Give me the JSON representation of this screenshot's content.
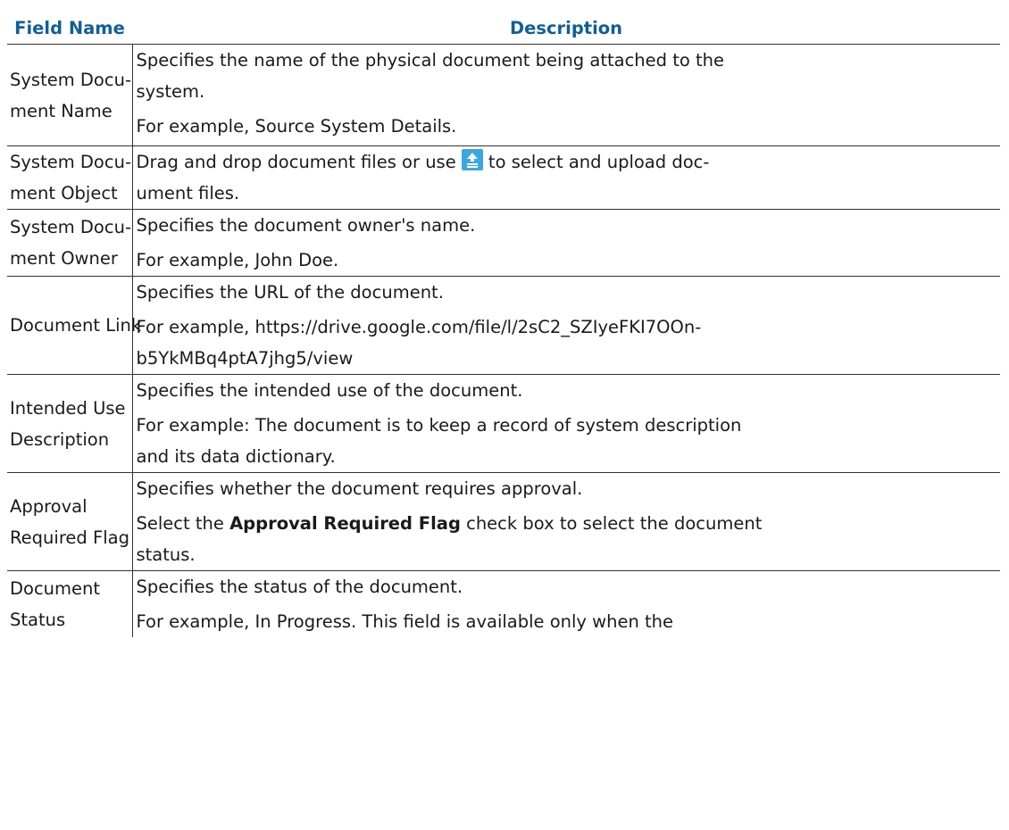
{
  "header": {
    "field_name": "Field Name",
    "description": "Description"
  },
  "rows": [
    {
      "field": [
        "System Docu-",
        "ment Name"
      ],
      "desc": [
        [
          "Specifies the name of the physical document being attached to the",
          "system."
        ],
        [
          "For example, Source System Details."
        ]
      ]
    },
    {
      "field": [
        "System Docu-",
        "ment Object"
      ],
      "desc_before_icon": "Drag and drop document files or use ",
      "desc_after_icon": "to select and upload doc-",
      "desc_line2": "ument files.",
      "icon": "upload-icon"
    },
    {
      "field": [
        "System Docu-",
        "ment Owner"
      ],
      "desc": [
        [
          "Specifies the document owner's name."
        ],
        [
          "For example, John Doe."
        ]
      ]
    },
    {
      "field": [
        "Document Link"
      ],
      "desc": [
        [
          "Specifies the URL of the document."
        ],
        [
          "For example, https://drive.google.com/file/l/2sC2_SZIyeFKI7OOn-",
          "b5YkMBq4ptA7jhg5/view"
        ]
      ]
    },
    {
      "field": [
        "Intended Use",
        "Description"
      ],
      "desc": [
        [
          "Specifies the intended use of the document."
        ],
        [
          "For example: The document is to keep a record of system description",
          "and its data dictionary."
        ]
      ]
    },
    {
      "field": [
        "Approval",
        "Required Flag"
      ],
      "desc_p1": "Specifies whether the document requires approval.",
      "desc_p2_before": "Select the ",
      "desc_p2_bold": "Approval Required Flag",
      "desc_p2_after": " check box to select the document",
      "desc_p2_line2": "status."
    },
    {
      "field": [
        "Document",
        "Status"
      ],
      "desc": [
        [
          "Specifies the status of the document."
        ],
        [
          "For example, In Progress. This field is available only when the"
        ]
      ]
    }
  ],
  "colors": {
    "header_text": "#0f5f9a",
    "icon_bg": "#3aa8e0"
  }
}
